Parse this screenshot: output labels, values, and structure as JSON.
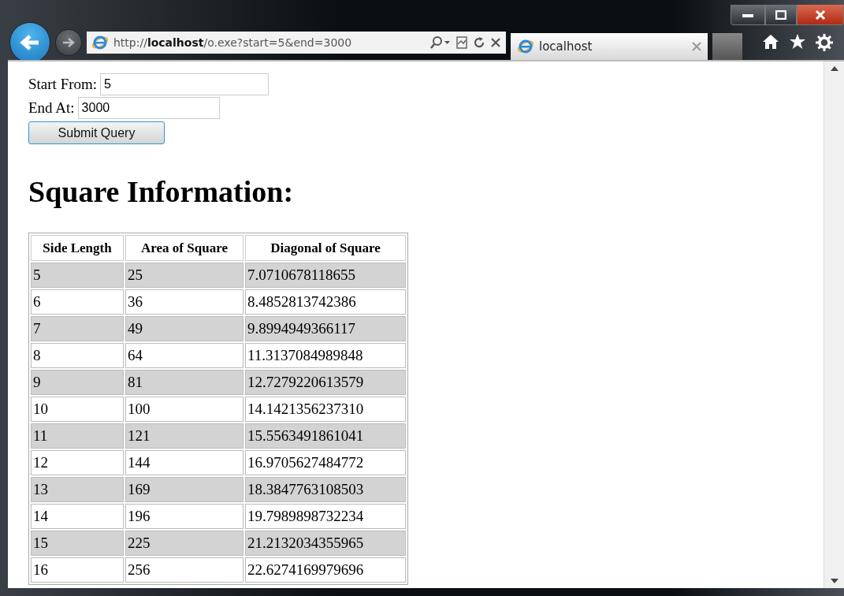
{
  "browser": {
    "address": {
      "prefix": "http://",
      "host": "localhost",
      "path": "/o.exe?start=5&end=3000"
    },
    "tabs": [
      {
        "label": "localhost",
        "selected": true
      }
    ]
  },
  "form": {
    "fields": [
      {
        "label": "Start From:",
        "value": "5"
      },
      {
        "label": "End At:",
        "value": "3000"
      }
    ],
    "submit": "Submit Query"
  },
  "heading": "Square Information:",
  "table": {
    "columns": [
      "Side Length",
      "Area of Square",
      "Diagonal of Square"
    ],
    "rows": [
      {
        "cells": [
          "5",
          "25",
          "7.0710678118655"
        ],
        "shaded": true
      },
      {
        "cells": [
          "6",
          "36",
          "8.4852813742386"
        ],
        "shaded": false
      },
      {
        "cells": [
          "7",
          "49",
          "9.8994949366117"
        ],
        "shaded": true
      },
      {
        "cells": [
          "8",
          "64",
          "11.3137084989848"
        ],
        "shaded": false
      },
      {
        "cells": [
          "9",
          "81",
          "12.7279220613579"
        ],
        "shaded": true
      },
      {
        "cells": [
          "10",
          "100",
          "14.1421356237310"
        ],
        "shaded": false
      },
      {
        "cells": [
          "11",
          "121",
          "15.5563491861041"
        ],
        "shaded": true
      },
      {
        "cells": [
          "12",
          "144",
          "16.9705627484772"
        ],
        "shaded": false
      },
      {
        "cells": [
          "13",
          "169",
          "18.3847763108503"
        ],
        "shaded": true
      },
      {
        "cells": [
          "14",
          "196",
          "19.7989898732234"
        ],
        "shaded": false
      },
      {
        "cells": [
          "15",
          "225",
          "21.2132034355965"
        ],
        "shaded": true
      },
      {
        "cells": [
          "16",
          "256",
          "22.6274169979696"
        ],
        "shaded": false
      }
    ]
  }
}
